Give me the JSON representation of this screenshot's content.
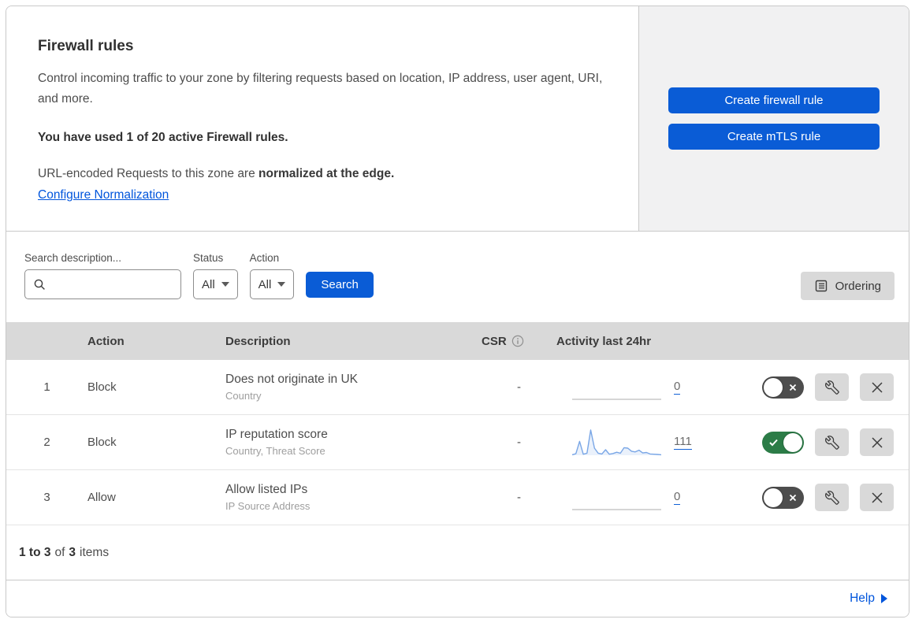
{
  "colors": {
    "accent_blue": "#0a5cd6",
    "link_blue": "#0055dc",
    "toggle_on_green": "#2c7c47",
    "toggle_off_gray": "#4d4d4d",
    "sparkline_blue": "#79a6e6",
    "table_header_gray": "#d9d9d9",
    "panel_gray": "#f1f1f2"
  },
  "icons": {
    "search": "magnifier-icon",
    "info": "circled-i-icon",
    "ordering": "list-icon",
    "wrench": "wrench-icon",
    "delete": "x-icon",
    "toggle_on": "check-icon",
    "toggle_off": "x-icon",
    "dropdown": "caret-down-icon",
    "help": "right-triangle-icon"
  },
  "intro": {
    "title": "Firewall rules",
    "description": "Control incoming traffic to your zone by filtering requests based on location, IP address, user agent, URI, and more.",
    "usage": "You have used 1 of 20 active Firewall rules.",
    "normalization_prefix": "URL-encoded Requests to this zone are ",
    "normalization_bold": "normalized at the edge.",
    "normalization_link": "Configure Normalization",
    "create_firewall_button": "Create firewall rule",
    "create_mtls_button": "Create mTLS rule"
  },
  "filters": {
    "search_label": "Search description...",
    "search_placeholder": "",
    "search_value": "",
    "status_label": "Status",
    "status_value": "All",
    "action_label": "Action",
    "action_value": "All",
    "search_button": "Search",
    "ordering_button": "Ordering"
  },
  "table": {
    "headers": {
      "action": "Action",
      "description": "Description",
      "csr": "CSR",
      "activity": "Activity last 24hr"
    },
    "rows": [
      {
        "priority": "1",
        "action": "Block",
        "description": "Does not originate in UK",
        "criteria": "Country",
        "csr": "-",
        "activity_count": "0",
        "enabled": false,
        "sparkline": [
          0,
          0,
          0,
          0,
          0,
          0,
          0,
          0,
          0,
          0,
          0,
          0,
          0,
          0,
          0,
          0,
          0,
          0,
          0,
          0,
          0,
          0,
          0,
          0,
          0
        ]
      },
      {
        "priority": "2",
        "action": "Block",
        "description": "IP reputation score",
        "criteria": "Country, Threat Score",
        "csr": "-",
        "activity_count": "111",
        "enabled": true,
        "sparkline": [
          2,
          6,
          55,
          4,
          8,
          100,
          28,
          8,
          5,
          22,
          4,
          7,
          12,
          8,
          30,
          28,
          16,
          13,
          20,
          9,
          11,
          5,
          4,
          3,
          2
        ]
      },
      {
        "priority": "3",
        "action": "Allow",
        "description": "Allow listed IPs",
        "criteria": "IP Source Address",
        "csr": "-",
        "activity_count": "0",
        "enabled": false,
        "sparkline": [
          0,
          0,
          0,
          0,
          0,
          0,
          0,
          0,
          0,
          0,
          0,
          0,
          0,
          0,
          0,
          0,
          0,
          0,
          0,
          0,
          0,
          0,
          0,
          0,
          0
        ]
      }
    ]
  },
  "footer": {
    "range": "1 to 3",
    "of": "of",
    "total": "3",
    "items": "items",
    "help_label": "Help"
  }
}
